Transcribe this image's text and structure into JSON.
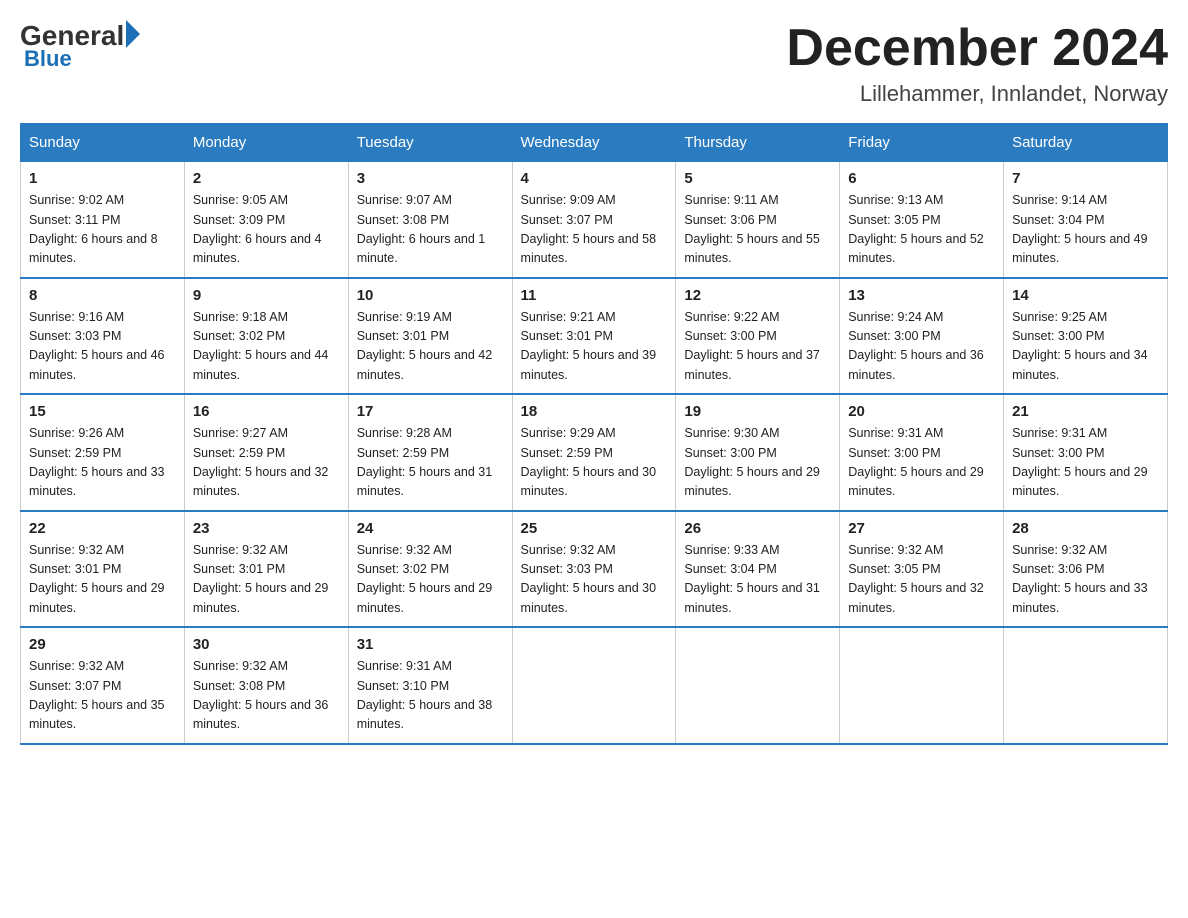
{
  "header": {
    "logo_general": "General",
    "logo_blue": "Blue",
    "month_title": "December 2024",
    "location": "Lillehammer, Innlandet, Norway"
  },
  "columns": [
    "Sunday",
    "Monday",
    "Tuesday",
    "Wednesday",
    "Thursday",
    "Friday",
    "Saturday"
  ],
  "weeks": [
    [
      {
        "day": "1",
        "sunrise": "9:02 AM",
        "sunset": "3:11 PM",
        "daylight": "6 hours and 8 minutes."
      },
      {
        "day": "2",
        "sunrise": "9:05 AM",
        "sunset": "3:09 PM",
        "daylight": "6 hours and 4 minutes."
      },
      {
        "day": "3",
        "sunrise": "9:07 AM",
        "sunset": "3:08 PM",
        "daylight": "6 hours and 1 minute."
      },
      {
        "day": "4",
        "sunrise": "9:09 AM",
        "sunset": "3:07 PM",
        "daylight": "5 hours and 58 minutes."
      },
      {
        "day": "5",
        "sunrise": "9:11 AM",
        "sunset": "3:06 PM",
        "daylight": "5 hours and 55 minutes."
      },
      {
        "day": "6",
        "sunrise": "9:13 AM",
        "sunset": "3:05 PM",
        "daylight": "5 hours and 52 minutes."
      },
      {
        "day": "7",
        "sunrise": "9:14 AM",
        "sunset": "3:04 PM",
        "daylight": "5 hours and 49 minutes."
      }
    ],
    [
      {
        "day": "8",
        "sunrise": "9:16 AM",
        "sunset": "3:03 PM",
        "daylight": "5 hours and 46 minutes."
      },
      {
        "day": "9",
        "sunrise": "9:18 AM",
        "sunset": "3:02 PM",
        "daylight": "5 hours and 44 minutes."
      },
      {
        "day": "10",
        "sunrise": "9:19 AM",
        "sunset": "3:01 PM",
        "daylight": "5 hours and 42 minutes."
      },
      {
        "day": "11",
        "sunrise": "9:21 AM",
        "sunset": "3:01 PM",
        "daylight": "5 hours and 39 minutes."
      },
      {
        "day": "12",
        "sunrise": "9:22 AM",
        "sunset": "3:00 PM",
        "daylight": "5 hours and 37 minutes."
      },
      {
        "day": "13",
        "sunrise": "9:24 AM",
        "sunset": "3:00 PM",
        "daylight": "5 hours and 36 minutes."
      },
      {
        "day": "14",
        "sunrise": "9:25 AM",
        "sunset": "3:00 PM",
        "daylight": "5 hours and 34 minutes."
      }
    ],
    [
      {
        "day": "15",
        "sunrise": "9:26 AM",
        "sunset": "2:59 PM",
        "daylight": "5 hours and 33 minutes."
      },
      {
        "day": "16",
        "sunrise": "9:27 AM",
        "sunset": "2:59 PM",
        "daylight": "5 hours and 32 minutes."
      },
      {
        "day": "17",
        "sunrise": "9:28 AM",
        "sunset": "2:59 PM",
        "daylight": "5 hours and 31 minutes."
      },
      {
        "day": "18",
        "sunrise": "9:29 AM",
        "sunset": "2:59 PM",
        "daylight": "5 hours and 30 minutes."
      },
      {
        "day": "19",
        "sunrise": "9:30 AM",
        "sunset": "3:00 PM",
        "daylight": "5 hours and 29 minutes."
      },
      {
        "day": "20",
        "sunrise": "9:31 AM",
        "sunset": "3:00 PM",
        "daylight": "5 hours and 29 minutes."
      },
      {
        "day": "21",
        "sunrise": "9:31 AM",
        "sunset": "3:00 PM",
        "daylight": "5 hours and 29 minutes."
      }
    ],
    [
      {
        "day": "22",
        "sunrise": "9:32 AM",
        "sunset": "3:01 PM",
        "daylight": "5 hours and 29 minutes."
      },
      {
        "day": "23",
        "sunrise": "9:32 AM",
        "sunset": "3:01 PM",
        "daylight": "5 hours and 29 minutes."
      },
      {
        "day": "24",
        "sunrise": "9:32 AM",
        "sunset": "3:02 PM",
        "daylight": "5 hours and 29 minutes."
      },
      {
        "day": "25",
        "sunrise": "9:32 AM",
        "sunset": "3:03 PM",
        "daylight": "5 hours and 30 minutes."
      },
      {
        "day": "26",
        "sunrise": "9:33 AM",
        "sunset": "3:04 PM",
        "daylight": "5 hours and 31 minutes."
      },
      {
        "day": "27",
        "sunrise": "9:32 AM",
        "sunset": "3:05 PM",
        "daylight": "5 hours and 32 minutes."
      },
      {
        "day": "28",
        "sunrise": "9:32 AM",
        "sunset": "3:06 PM",
        "daylight": "5 hours and 33 minutes."
      }
    ],
    [
      {
        "day": "29",
        "sunrise": "9:32 AM",
        "sunset": "3:07 PM",
        "daylight": "5 hours and 35 minutes."
      },
      {
        "day": "30",
        "sunrise": "9:32 AM",
        "sunset": "3:08 PM",
        "daylight": "5 hours and 36 minutes."
      },
      {
        "day": "31",
        "sunrise": "9:31 AM",
        "sunset": "3:10 PM",
        "daylight": "5 hours and 38 minutes."
      },
      null,
      null,
      null,
      null
    ]
  ]
}
